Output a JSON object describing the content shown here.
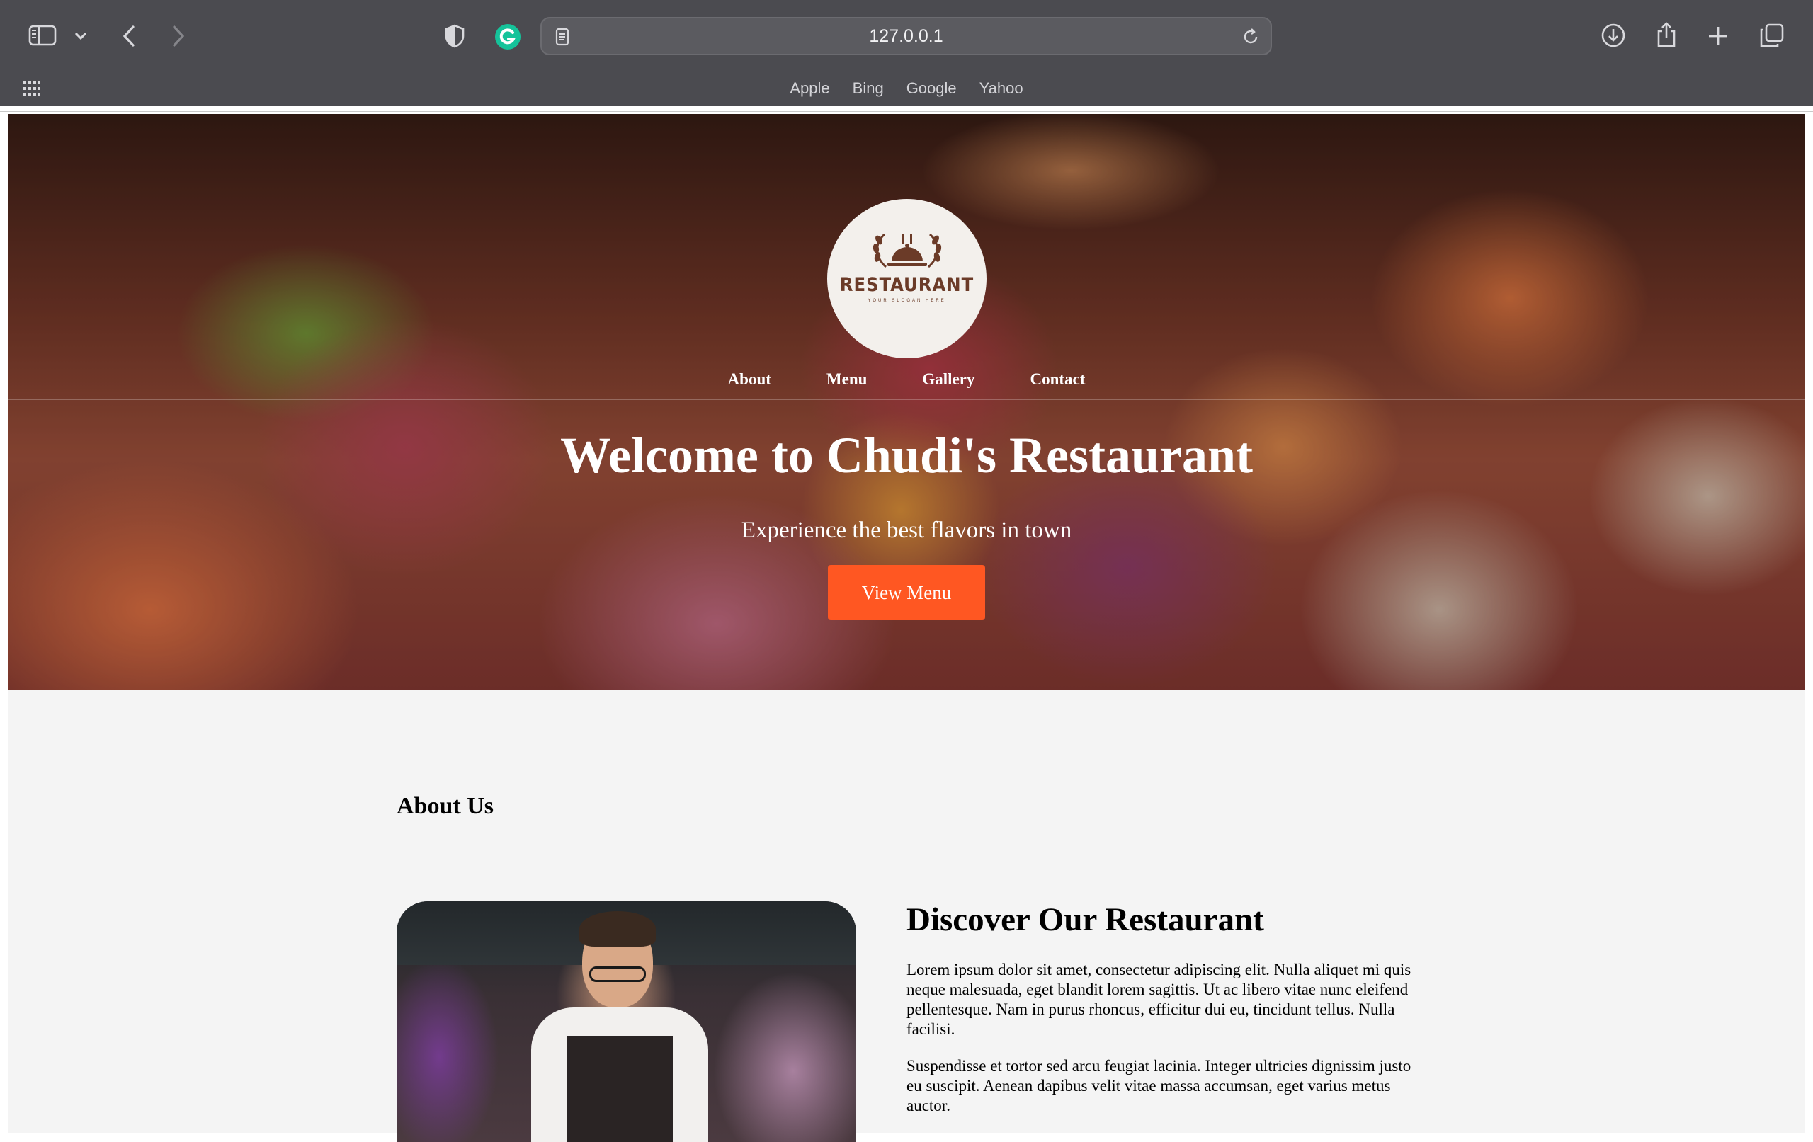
{
  "browser": {
    "url": "127.0.0.1",
    "bookmarks": [
      "Apple",
      "Bing",
      "Google",
      "Yahoo"
    ]
  },
  "hero": {
    "logo": {
      "brand": "RESTAURANT",
      "slogan": "YOUR SLOGAN HERE",
      "colors": {
        "badge": "#f3f0ec",
        "mark": "#6b3b28"
      }
    },
    "nav": [
      {
        "label": "About"
      },
      {
        "label": "Menu"
      },
      {
        "label": "Gallery"
      },
      {
        "label": "Contact"
      }
    ],
    "title": "Welcome to Chudi's Restaurant",
    "subtitle": "Experience the best flavors in town",
    "cta_label": "View Menu",
    "cta_color": "#ff5722"
  },
  "about": {
    "heading": "About Us",
    "subheading": "Discover Our Restaurant",
    "paragraphs": [
      "Lorem ipsum dolor sit amet, consectetur adipiscing elit. Nulla aliquet mi quis neque malesuada, eget blandit lorem sagittis. Ut ac libero vitae nunc eleifend pellentesque. Nam in purus rhoncus, efficitur dui eu, tincidunt tellus. Nulla facilisi.",
      "Suspendisse et tortor sed arcu feugiat lacinia. Integer ultricies dignissim justo eu suscipit. Aenean dapibus velit vitae massa accumsan, eget varius metus auctor."
    ],
    "background": "#f4f4f4"
  }
}
